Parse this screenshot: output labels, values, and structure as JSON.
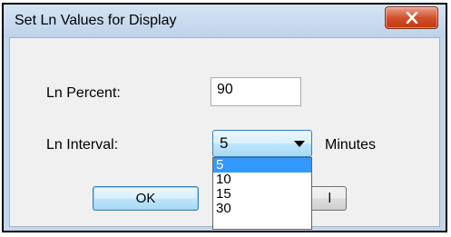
{
  "window": {
    "title": "Set Ln Values for Display"
  },
  "form": {
    "ln_percent_label": "Ln Percent:",
    "ln_percent_value": "90",
    "ln_interval_label": "Ln Interval:",
    "ln_interval_selected": "5",
    "minutes_label": "Minutes"
  },
  "dropdown": {
    "options": [
      "5",
      "10",
      "15",
      "30"
    ],
    "highlighted": "5"
  },
  "buttons": {
    "ok_label": "OK",
    "cancel_label_visible": "l"
  },
  "colors": {
    "titlebar": "#c4d6ea",
    "close_button": "#c8421a",
    "selection": "#3399ff",
    "dialog_background": "#f0f0f0"
  },
  "icons": {
    "close": "close-x-icon",
    "dropdown": "chevron-down-icon"
  }
}
